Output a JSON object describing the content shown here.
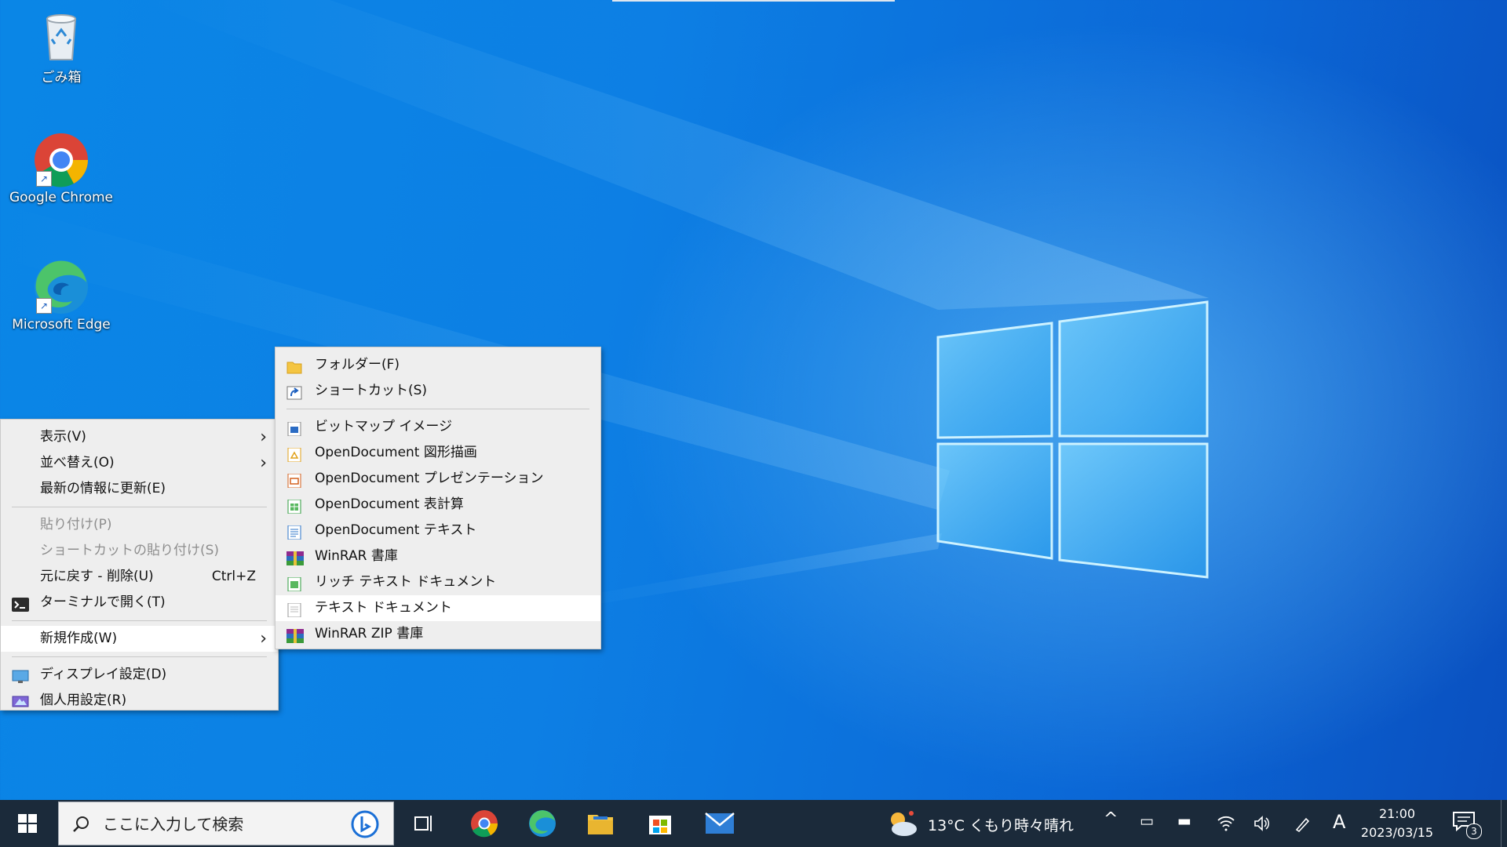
{
  "desktop": {
    "icons": [
      {
        "label": "ごみ箱",
        "icon": "recycle-bin-icon"
      },
      {
        "label": "Google Chrome",
        "icon": "chrome-icon"
      },
      {
        "label": "Microsoft Edge",
        "icon": "edge-icon"
      }
    ]
  },
  "context_menu": {
    "items": [
      {
        "label": "表示(V)",
        "has_submenu": true
      },
      {
        "label": "並べ替え(O)",
        "has_submenu": true
      },
      {
        "label": "最新の情報に更新(E)"
      },
      {
        "label": "貼り付け(P)",
        "disabled": true
      },
      {
        "label": "ショートカットの貼り付け(S)",
        "disabled": true
      },
      {
        "label": "元に戻す - 削除(U)",
        "shortcut": "Ctrl+Z"
      },
      {
        "label": "ターミナルで開く(T)",
        "icon": "terminal-icon"
      },
      {
        "label": "新規作成(W)",
        "has_submenu": true,
        "highlighted": true
      },
      {
        "label": "ディスプレイ設定(D)",
        "icon": "display-settings-icon"
      },
      {
        "label": "個人用設定(R)",
        "icon": "personalize-icon"
      }
    ]
  },
  "new_submenu": {
    "items": [
      {
        "label": "フォルダー(F)",
        "icon": "folder-icon"
      },
      {
        "label": "ショートカット(S)",
        "icon": "shortcut-icon"
      },
      {
        "label": "ビットマップ イメージ",
        "icon": "bitmap-icon"
      },
      {
        "label": "OpenDocument 図形描画",
        "icon": "odg-icon"
      },
      {
        "label": "OpenDocument プレゼンテーション",
        "icon": "odp-icon"
      },
      {
        "label": "OpenDocument 表計算",
        "icon": "ods-icon"
      },
      {
        "label": "OpenDocument テキスト",
        "icon": "odt-icon"
      },
      {
        "label": "WinRAR 書庫",
        "icon": "winrar-icon"
      },
      {
        "label": "リッチ テキスト ドキュメント",
        "icon": "rtf-icon"
      },
      {
        "label": "テキスト ドキュメント",
        "icon": "text-document-icon",
        "highlighted": true
      },
      {
        "label": "WinRAR ZIP 書庫",
        "icon": "winrar-zip-icon"
      }
    ]
  },
  "taskbar": {
    "search_placeholder": "ここに入力して検索",
    "weather": "13°C くもり時々晴れ",
    "ime": "A",
    "time": "21:00",
    "date": "2023/03/15",
    "notification_count": "3"
  },
  "colors": {
    "taskbar_bg": "#1b2a3a",
    "menu_bg": "#eeeeee",
    "desktop_blue": "#0b78e0"
  }
}
